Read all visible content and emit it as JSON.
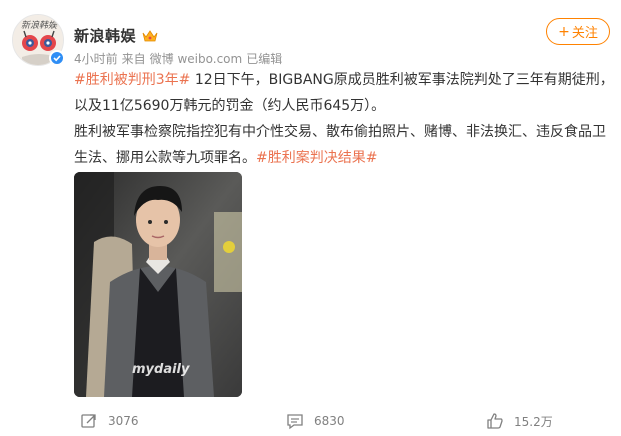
{
  "author": {
    "name": "新浪韩娱",
    "avatar_text": "新浪韩娱",
    "meta_time": "4小时前",
    "meta_source_prefix": "来自",
    "meta_source": "微博 weibo.com",
    "meta_edited": "已编辑"
  },
  "follow_button": {
    "label": "关注",
    "plus": "+"
  },
  "post": {
    "tag_1": "#胜利被判刑3年#",
    "text_1": " 12日下午，BIGBANG原成员胜利被军事法院判处了三年有期徒刑，以及11亿5690万韩元的罚金（约人民币645万）。",
    "text_2": "胜利被军事检察院指控犯有中介性交易、散布偷拍照片、赌博、非法换汇、违反食品卫生法、挪用公款等九项罪名。",
    "tag_2": "#胜利案判决结果#"
  },
  "photo": {
    "watermark": "mydaily"
  },
  "actions": {
    "repost_count": "3076",
    "comment_count": "6830",
    "like_count": "15.2万"
  },
  "colors": {
    "accent_orange": "#ff8200",
    "tag_color": "#eb7350",
    "verified_blue": "#2f8ef5",
    "meta_gray": "#939393"
  },
  "icons": [
    "verified-icon",
    "vip-badge-icon",
    "repost-icon",
    "comment-icon",
    "like-icon"
  ]
}
